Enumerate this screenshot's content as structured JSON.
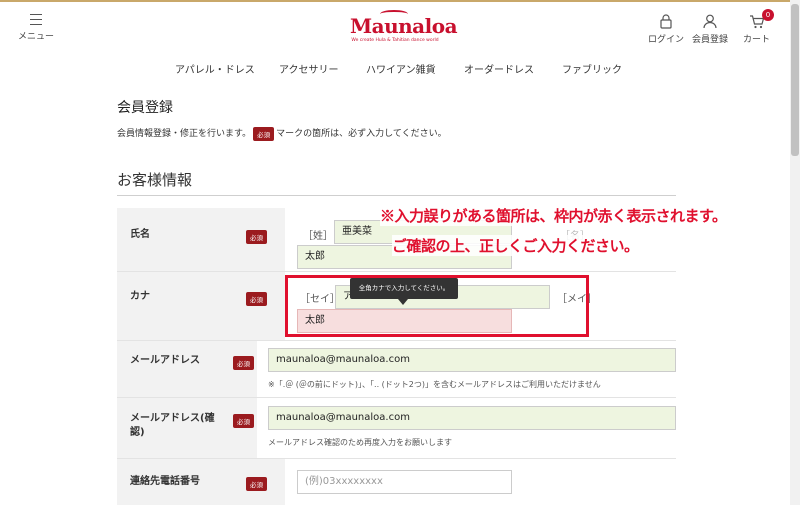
{
  "header": {
    "menu_label": "メニュー",
    "logo_text": "Maunaloa",
    "logo_tagline": "We create Hula & Tahitian dance world",
    "login_label": "ログイン",
    "register_label": "会員登録",
    "cart_label": "カート",
    "cart_count": "0"
  },
  "nav": [
    "アパレル・ドレス",
    "アクセサリー",
    "ハワイアン雑貨",
    "オーダードレス",
    "ファブリック"
  ],
  "page": {
    "title": "会員登録",
    "intro_before": "会員情報登録・修正を行います。",
    "intro_after": "マークの箇所は、必ず入力してください。",
    "required_badge": "必須",
    "section_title": "お客様情報"
  },
  "form": {
    "name": {
      "label": "氏名",
      "sei_bracket": "［姓］",
      "sei_value": "亜美菜",
      "mei_bracket": "［名］",
      "mei_value": "太郎"
    },
    "kana": {
      "label": "カナ",
      "sei_bracket": "［セイ］",
      "sei_value": "ア",
      "mei_bracket": "［メイ］",
      "mei_value": "太郎",
      "tooltip": "全角カナで入力してください。"
    },
    "email": {
      "label": "メールアドレス",
      "value": "maunaloa@maunaloa.com",
      "note": "※「.＠ (＠の前にドット)」、「.. (ドット2つ)」を含むメールアドレスはご利用いただけません"
    },
    "email_confirm": {
      "label_line1": "メールアドレス(確",
      "label_line2": "認)",
      "value": "maunaloa@maunaloa.com",
      "note": "メールアドレス確認のため再度入力をお願いします"
    },
    "phone": {
      "label": "連絡先電話番号",
      "placeholder": "(例)03xxxxxxxx"
    }
  },
  "callout": {
    "line1": "※入力誤りがある箇所は、枠内が赤く表示されます。",
    "line2": "ご確認の上、正しくご入力ください。"
  },
  "colors": {
    "brand_red": "#c8102e",
    "error_border": "#e0102e",
    "required_badge": "#9b1b1f",
    "valid_field": "#eef5e0",
    "error_field": "#f7dede"
  }
}
